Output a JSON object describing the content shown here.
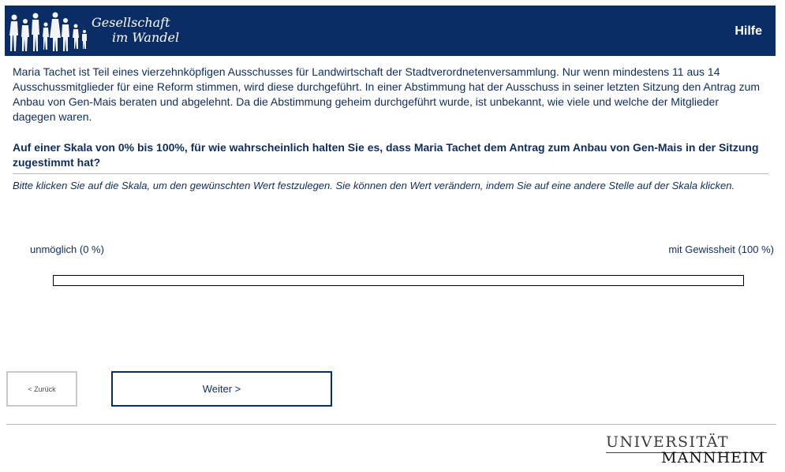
{
  "header": {
    "logo_line1": "Gesellschaft",
    "logo_line2": "im Wandel",
    "help_label": "Hilfe",
    "background_color": "#0a2d65"
  },
  "survey": {
    "intro_text": "Maria Tachet ist Teil eines vierzehnköpfigen Ausschusses für Landwirtschaft der Stadtverordnetenversammlung. Nur wenn mindestens 11 aus 14 Ausschussmitglieder für eine Reform stimmen, wird diese durchgeführt. In einer Abstimmung hat der Ausschuss in seiner letzten Sitzung den Antrag zum Anbau von Gen-Mais beraten und abgelehnt. Da die Abstimmung geheim durchgeführt wurde, ist unbekannt, wie viele und welche der Mitglieder dagegen waren.",
    "question": "Auf einer Skala von 0% bis 100%, für wie wahrscheinlich halten Sie es, dass Maria Tachet dem Antrag zum Anbau von Gen-Mais in der Sitzung zugestimmt hat?",
    "instruction": "Bitte klicken Sie auf die Skala, um den gewünschten Wert festzulegen. Sie können den Wert verändern, indem Sie auf eine andere Stelle auf der Skala klicken.",
    "scale_min_label": "unmöglich (0 %)",
    "scale_max_label": "mit Gewissheit (100 %)"
  },
  "navigation": {
    "back_label": "< Zurück",
    "next_label": "Weiter >"
  },
  "footer": {
    "university_line1": "UNIVERSITÄT",
    "university_line2": "MANNHEIM"
  }
}
